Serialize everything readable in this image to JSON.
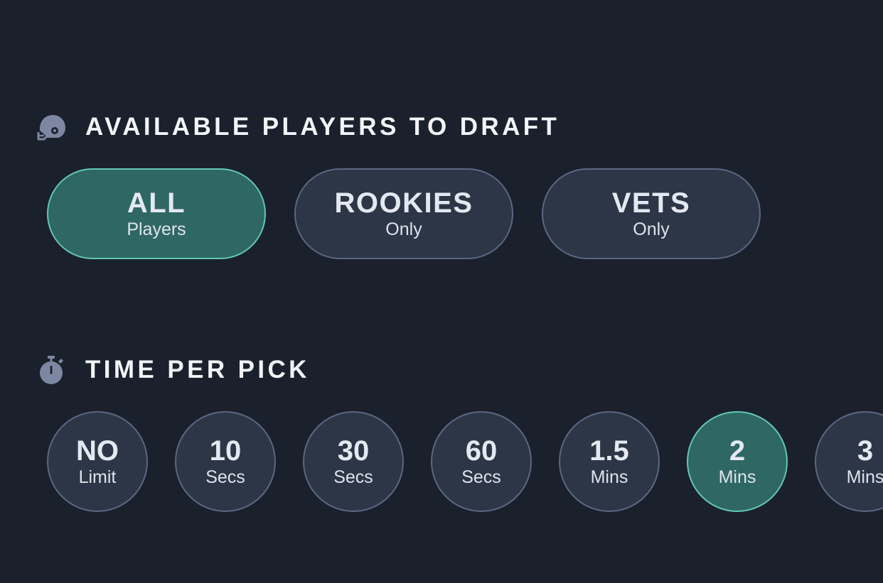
{
  "players_section": {
    "title": "AVAILABLE PLAYERS TO DRAFT",
    "icon": "helmet-icon",
    "options": [
      {
        "main": "ALL",
        "sub": "Players",
        "selected": true
      },
      {
        "main": "ROOKIES",
        "sub": "Only",
        "selected": false
      },
      {
        "main": "VETS",
        "sub": "Only",
        "selected": false
      }
    ]
  },
  "time_section": {
    "title": "TIME PER PICK",
    "icon": "stopwatch-icon",
    "options": [
      {
        "main": "NO",
        "sub": "Limit",
        "selected": false
      },
      {
        "main": "10",
        "sub": "Secs",
        "selected": false
      },
      {
        "main": "30",
        "sub": "Secs",
        "selected": false
      },
      {
        "main": "60",
        "sub": "Secs",
        "selected": false
      },
      {
        "main": "1.5",
        "sub": "Mins",
        "selected": false
      },
      {
        "main": "2",
        "sub": "Mins",
        "selected": true
      },
      {
        "main": "3",
        "sub": "Mins",
        "selected": false
      }
    ]
  },
  "colors": {
    "background": "#1b202d",
    "option_bg": "#2d3647",
    "option_border": "#5b6782",
    "selected_bg": "#2f6764",
    "selected_border": "#62c7b2",
    "icon": "#7d87a1"
  }
}
